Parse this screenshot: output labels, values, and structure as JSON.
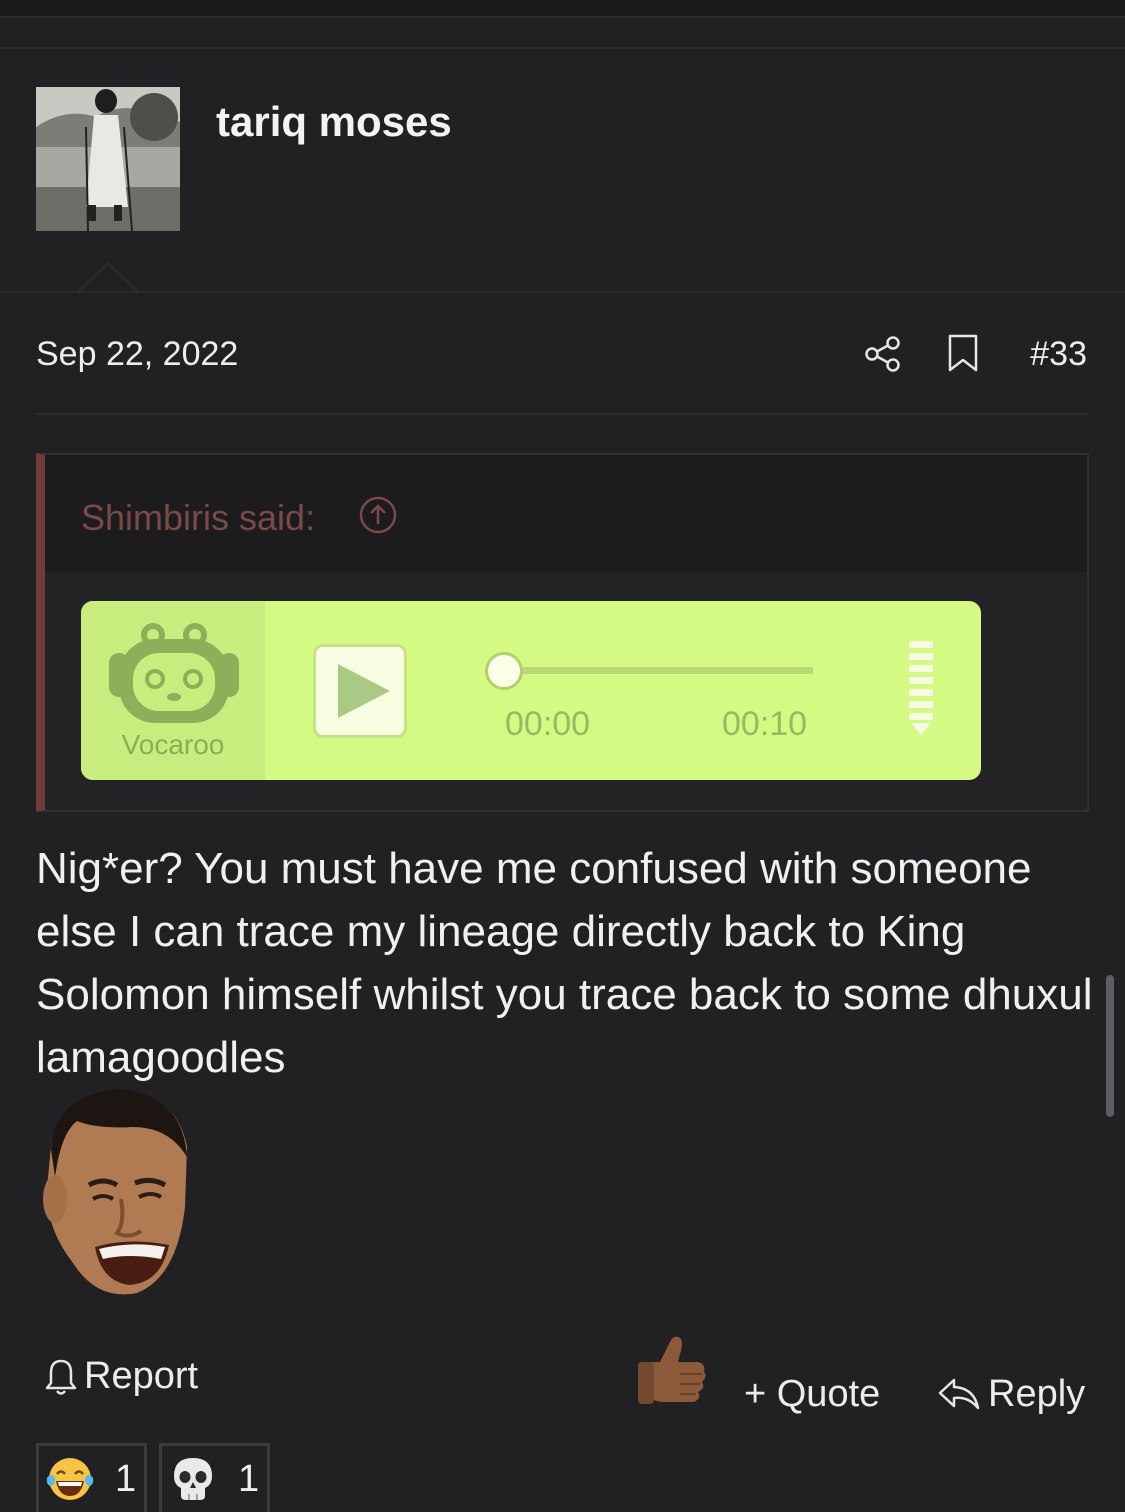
{
  "post": {
    "username": "tariq moses",
    "date": "Sep 22, 2022",
    "number": "#33",
    "icons": {
      "share": "share-icon",
      "bookmark": "bookmark-icon"
    }
  },
  "quote": {
    "author_said": "Shimbiris said:",
    "jump_icon": "arrow-up-circle-icon",
    "player": {
      "brand": "Vocaroo",
      "current_time": "00:00",
      "total_time": "00:10",
      "progress": 0
    }
  },
  "message": "Nig*er? You must have me confused with someone else I can trace my lineage directly back to King Solomon himself whilst you trace back to some dhuxul lamagoodles",
  "actions": {
    "report": "Report",
    "quote": "+ Quote",
    "reply": "Reply"
  },
  "reactions": [
    {
      "icon": "laughing-tears-emoji",
      "count": "1"
    },
    {
      "icon": "skull-emoji",
      "count": "1"
    }
  ],
  "colors": {
    "background": "#212123",
    "quote_border": "#6f3b38",
    "quote_author": "#7a4a46",
    "vocaroo_green": "#d4fa84"
  }
}
